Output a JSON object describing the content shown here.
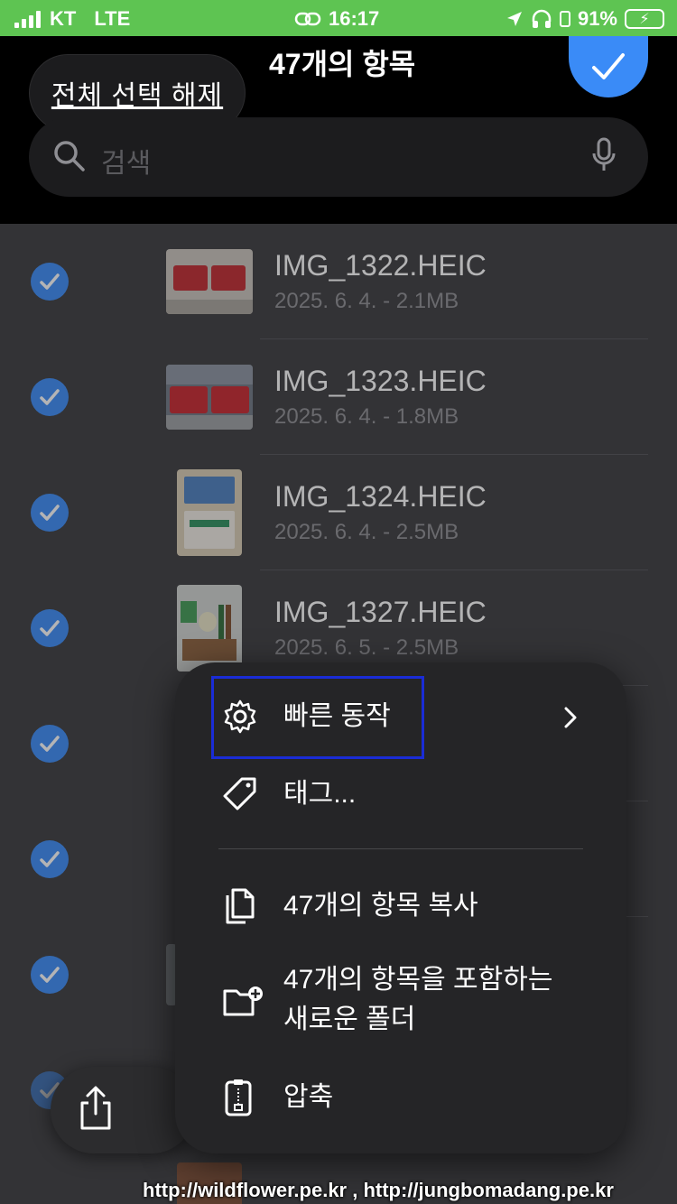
{
  "status_bar": {
    "carrier": "KT",
    "network": "LTE",
    "time": "16:17",
    "battery": "91%"
  },
  "header": {
    "deselect_all_label": "전체 선택 해제",
    "item_count_title": "47개의 항목",
    "search_placeholder": "검색"
  },
  "files": [
    {
      "name": "IMG_1322.HEIC",
      "meta": "2025. 6. 4. - 2.1MB",
      "selected": true
    },
    {
      "name": "IMG_1323.HEIC",
      "meta": "2025. 6. 4. - 1.8MB",
      "selected": true
    },
    {
      "name": "IMG_1324.HEIC",
      "meta": "2025. 6. 4. - 2.5MB",
      "selected": true
    },
    {
      "name": "IMG_1327.HEIC",
      "meta": "2025. 6. 5. - 2.5MB",
      "selected": true
    }
  ],
  "context_menu": {
    "items": [
      {
        "label": "빠른 동작",
        "icon": "gear-icon"
      },
      {
        "label": "태그...",
        "icon": "tag-icon"
      },
      {
        "label": "47개의 항목 복사",
        "icon": "copy-icon"
      },
      {
        "label_line1": "47개의 항목을 포함하는",
        "label_line2": "새로운 폴더",
        "icon": "folder-add-icon"
      },
      {
        "label": "압축",
        "icon": "archive-icon"
      }
    ]
  },
  "watermark": "http://wildflower.pe.kr , http://jungbomadang.pe.kr",
  "colors": {
    "accent": "#3a8bf7",
    "status_bar": "#5ec452",
    "highlight_box": "#1a2cd6"
  }
}
